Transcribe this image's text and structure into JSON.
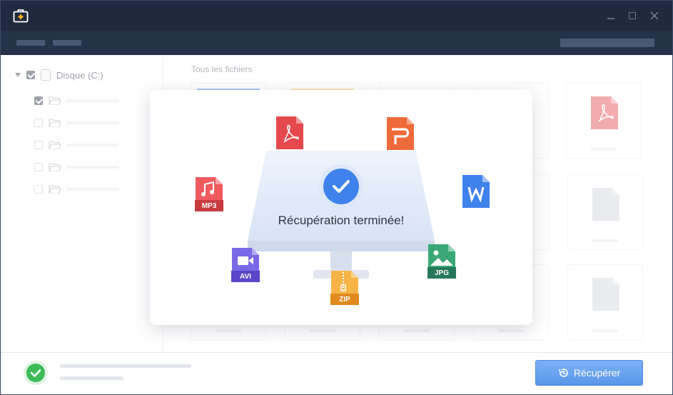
{
  "window": {
    "app_icon": "first-aid-kit-icon",
    "controls": [
      "minimize-icon",
      "maximize-icon",
      "close-icon"
    ]
  },
  "sidebar": {
    "root": {
      "label": "Disque (C:)",
      "checked": true,
      "expanded": true,
      "icon": "disk-icon"
    },
    "children": [
      {
        "checked": true,
        "icon": "folder-icon"
      },
      {
        "checked": false,
        "icon": "folder-icon"
      },
      {
        "checked": false,
        "icon": "folder-icon"
      },
      {
        "checked": false,
        "icon": "folder-icon"
      },
      {
        "checked": false,
        "icon": "folder-icon"
      }
    ]
  },
  "main": {
    "section_label": "Tous les fichiers"
  },
  "dialog": {
    "message": "Récupération terminée!",
    "file_types": [
      {
        "icon": "pdf-icon",
        "color": "#e5484d"
      },
      {
        "icon": "powerpoint-icon",
        "color": "#ef6a3a"
      },
      {
        "icon": "mp3-icon",
        "label": "MP3",
        "color": "#e5484d"
      },
      {
        "icon": "word-icon",
        "color": "#3f82ec"
      },
      {
        "icon": "avi-icon",
        "label": "AVI",
        "color": "#6a57d8"
      },
      {
        "icon": "zip-icon",
        "label": "ZIP",
        "color": "#f29a2e"
      },
      {
        "icon": "jpg-icon",
        "label": "JPG",
        "color": "#2f8c5f"
      }
    ]
  },
  "footer": {
    "status_icon": "check-circle-icon",
    "recover_button": "Récupérer",
    "recover_icon": "history-icon"
  },
  "colors": {
    "titlebar": "#1f2a40",
    "toolbar": "#263248",
    "accent": "#5a96ea",
    "success": "#3dbb58"
  }
}
